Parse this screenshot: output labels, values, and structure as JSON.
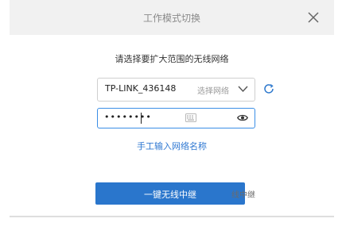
{
  "dialog": {
    "title": "工作模式切换",
    "prompt": "请选择要扩大范围的无线网络",
    "network_select": {
      "value": "TP-LINK_436148",
      "hint": "选择网络"
    },
    "password": {
      "masked_value": "••••••••"
    },
    "manual_entry_link": "手工输入网络名称",
    "primary_button_label": "一键无线中继",
    "ghost_label": "线中继"
  },
  "icons": {
    "close": "close-icon",
    "chevron": "chevron-down-icon",
    "refresh": "refresh-icon",
    "keyboard": "keyboard-icon",
    "eye": "eye-icon"
  },
  "colors": {
    "accent": "#2a76cc",
    "link": "#2f78d2",
    "focus_border": "#3a8ee6"
  }
}
